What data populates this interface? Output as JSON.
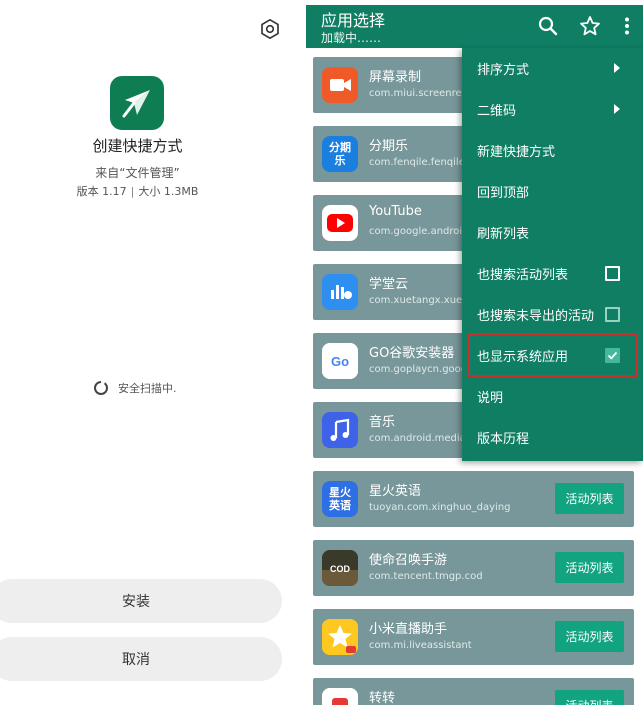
{
  "installer": {
    "app_name": "创建快捷方式",
    "source": "来自“文件管理”",
    "version": "版本 1.17",
    "size": "大小 1.3MB",
    "separator": "|",
    "scan_status": "安全扫描中.",
    "install_label": "安装",
    "cancel_label": "取消"
  },
  "toolbar": {
    "title": "应用选择",
    "subtitle": "加载中……"
  },
  "apps": [
    {
      "name": "屏幕录制",
      "package": "com.miui.screenrec",
      "button": "",
      "icon": "video-camera-icon",
      "color": "#f05a28"
    },
    {
      "name": "分期乐",
      "package": "com.fenqile.fenqile",
      "button": "",
      "icon": "fenqile-icon",
      "icon_text": "分期乐",
      "color": "#1b7fe0"
    },
    {
      "name": "YouTube",
      "package": "com.google.android.",
      "button": "",
      "icon": "youtube-icon",
      "color": "#ff0000"
    },
    {
      "name": "学堂云",
      "package": "com.xuetangx.xueta",
      "button": "",
      "icon": "cloud-icon",
      "color": "#2f8ff0"
    },
    {
      "name": "GO谷歌安装器",
      "package": "com.goplaycn.googl",
      "button": "",
      "icon": "go-installer-icon",
      "icon_text": "Go",
      "color": "#ffffff"
    },
    {
      "name": "音乐",
      "package": "com.android.mediaco",
      "button": "",
      "icon": "music-icon",
      "color": "#3f63e8"
    },
    {
      "name": "星火英语",
      "package": "tuoyan.com.xinghuo_daying",
      "button": "活动列表",
      "icon": "xinghuo-icon",
      "icon_text": "星火英语",
      "color": "#2f6fe6"
    },
    {
      "name": "使命召唤手游",
      "package": "com.tencent.tmgp.cod",
      "button": "活动列表",
      "icon": "call-of-duty-icon",
      "icon_text": "COD",
      "color": "#3a3a2a"
    },
    {
      "name": "小米直播助手",
      "package": "com.mi.liveassistant",
      "button": "活动列表",
      "icon": "live-star-icon",
      "color": "#ffc820"
    },
    {
      "name": "转转",
      "package": "",
      "button": "活动列表",
      "icon": "zhuanzhuan-icon",
      "color": "#ffffff"
    }
  ],
  "menu": {
    "items": [
      {
        "label": "排序方式",
        "type": "submenu"
      },
      {
        "label": "二维码",
        "type": "submenu"
      },
      {
        "label": "新建快捷方式",
        "type": "action"
      },
      {
        "label": "回到顶部",
        "type": "action"
      },
      {
        "label": "刷新列表",
        "type": "action"
      },
      {
        "label": "也搜索活动列表",
        "type": "checkbox",
        "checked": false
      },
      {
        "label": "也搜索未导出的活动",
        "type": "checkbox",
        "checked": false
      },
      {
        "label": "也显示系统应用",
        "type": "checkbox",
        "checked": true
      },
      {
        "label": "说明",
        "type": "action"
      },
      {
        "label": "版本历程",
        "type": "action"
      }
    ]
  },
  "colors": {
    "toolbar": "#0f7e63",
    "row": "#78979a",
    "row_button": "#12a380",
    "highlight": "#c9302c"
  }
}
